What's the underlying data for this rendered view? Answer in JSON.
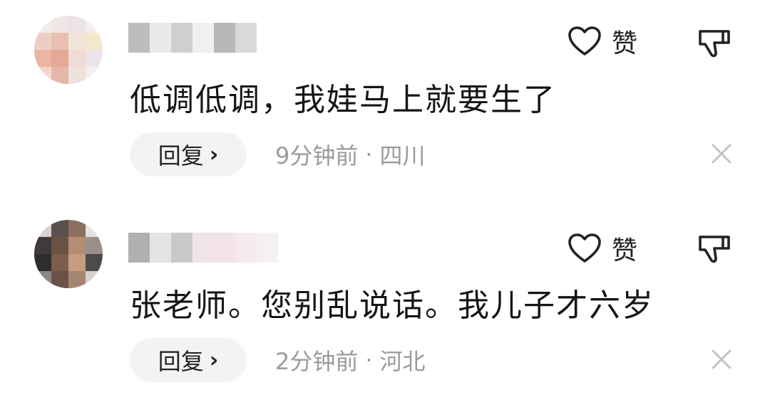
{
  "comments": [
    {
      "like_label": "赞",
      "text": "低调低调，我娃马上就要生了",
      "reply_label": "回复",
      "reply_chevron": "›",
      "time": "9分钟前",
      "separator": "·",
      "location": "四川"
    },
    {
      "like_label": "赞",
      "text": "张老师。您别乱说话。我儿子才六岁",
      "reply_label": "回复",
      "reply_chevron": "›",
      "time": "2分钟前",
      "separator": "·",
      "location": "河北"
    }
  ],
  "icons": {
    "like": "heart-outline-icon",
    "dislike": "thumbs-down-icon",
    "close": "close-icon"
  },
  "colors": {
    "meta_text": "#9b9b9b",
    "reply_bg": "#f3f3f3",
    "icon_stroke": "#222222",
    "close_icon": "#c4c4c4"
  }
}
